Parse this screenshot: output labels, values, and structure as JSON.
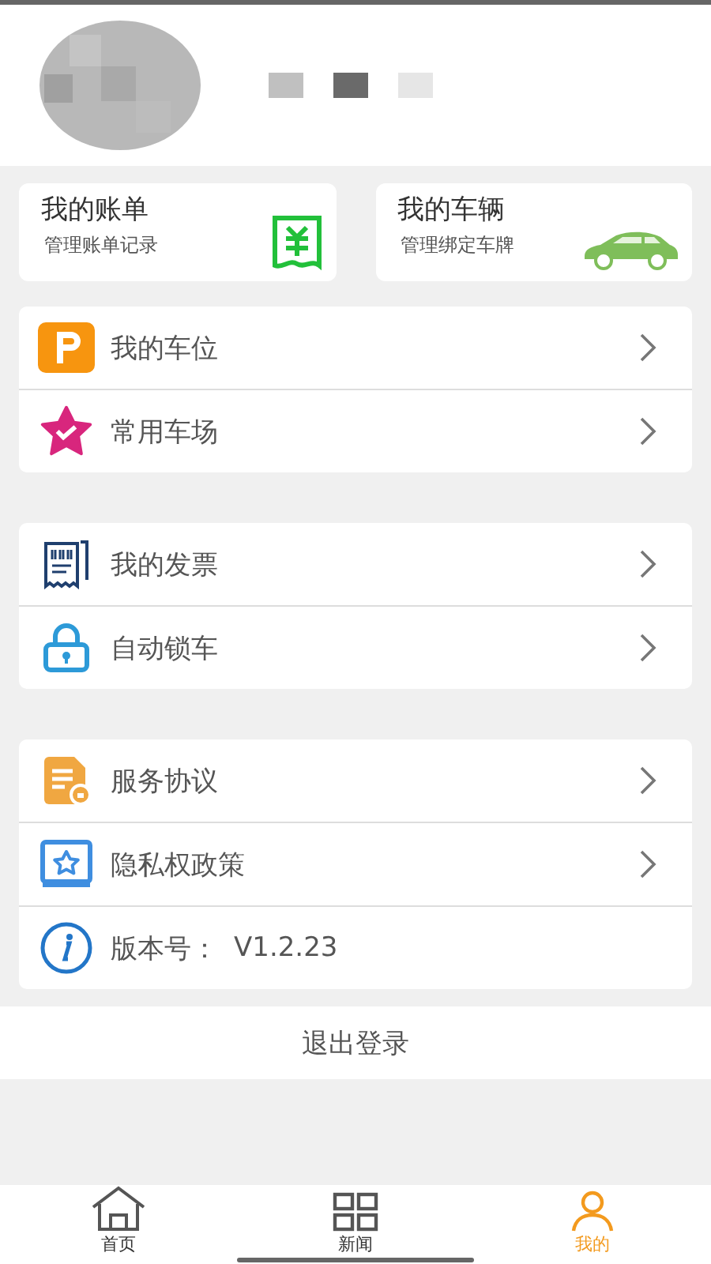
{
  "profile": {
    "avatar": {
      "kind": "picture"
    },
    "name": {
      "kind": "picture"
    }
  },
  "cards": [
    {
      "title": "我的账单",
      "subtitle": "管理账单记录"
    },
    {
      "title": "我的车辆",
      "subtitle": "管理绑定车牌"
    }
  ],
  "menu_groups": [
    [
      {
        "label": "我的车位",
        "kind": "link"
      },
      {
        "label": "常用车场",
        "kind": "link"
      }
    ],
    [
      {
        "label": "我的发票",
        "kind": "link"
      },
      {
        "label": "自动锁车",
        "kind": "link"
      }
    ],
    [
      {
        "label": "服务协议",
        "kind": "link"
      },
      {
        "label": "隐私权政策",
        "kind": "link"
      },
      {
        "label": "版本号：",
        "value": "V1.2.23",
        "kind": "info"
      }
    ]
  ],
  "logout": "退出登录",
  "tab_bar": [
    {
      "label": "首页",
      "selected": false
    },
    {
      "label": "新闻",
      "selected": false
    },
    {
      "label": "我的",
      "selected": true
    }
  ]
}
